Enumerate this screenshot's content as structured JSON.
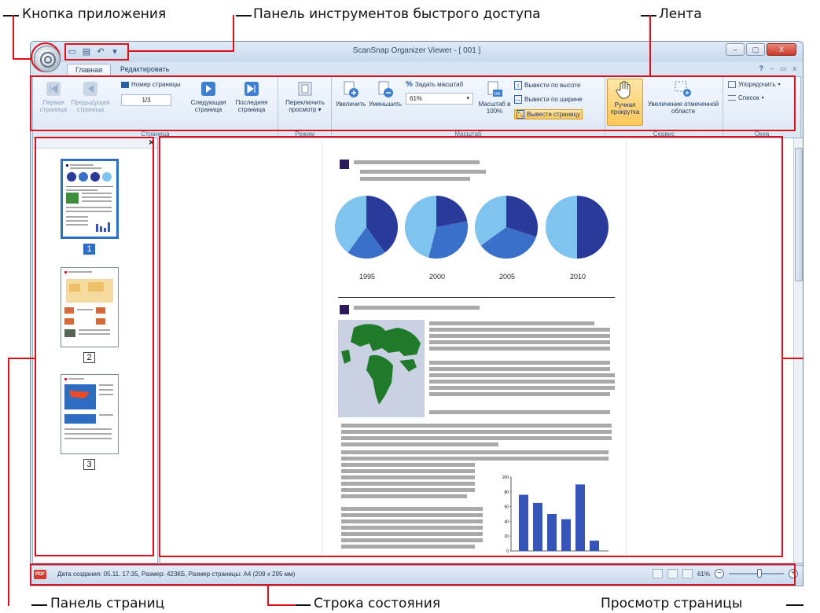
{
  "callouts": {
    "app_button": "Кнопка приложения",
    "quick_access": "Панель инструментов быстрого доступа",
    "ribbon": "Лента",
    "page_panel": "Панель страниц",
    "status_bar": "Строка состояния",
    "page_view": "Просмотр страницы"
  },
  "window": {
    "title": "ScanSnap Organizer Viewer - [ 001 ]",
    "controls": [
      "–",
      "▢",
      "X"
    ]
  },
  "qat_icons": [
    "save-icon",
    "print-icon",
    "back-icon",
    "dropdown-arrow-icon"
  ],
  "tabs": {
    "home": "Главная",
    "edit": "Редактировать",
    "right": [
      "?",
      "–",
      "▭",
      "x"
    ]
  },
  "ribbon": {
    "page_group": {
      "label": "Страница",
      "first": "Первая страница",
      "prev": "Предыдущая страница",
      "page_number_label": "Номер страницы",
      "page_number_value": "1/3",
      "next": "Следующая страница",
      "last": "Последняя страница"
    },
    "mode_group": {
      "label": "Режим",
      "switch_view": "Переключить просмотр"
    },
    "zoom_group": {
      "label": "Масштаб",
      "zoom_in": "Увеличить",
      "zoom_out": "Уменьшить",
      "set_zoom": "Задать масштаб",
      "zoom_value": "61%",
      "zoom_100": "Масштаб в 100%",
      "zoom_100_icon_text": "100",
      "fit_height": "Вывести по высоте",
      "fit_width": "Вывести по ширине",
      "fit_page": "Вывести страницу"
    },
    "service_group": {
      "label": "Сервис",
      "hand_scroll": "Ручная прокрутка",
      "zoom_area": "Увеличение отмеченной области"
    },
    "windows_group": {
      "label": "Окна",
      "arrange": "Упорядочить",
      "list": "Список"
    }
  },
  "page_panel": {
    "close": "×",
    "thumbnails": [
      {
        "num": "1",
        "selected": true
      },
      {
        "num": "2",
        "selected": false
      },
      {
        "num": "3",
        "selected": false
      }
    ]
  },
  "document": {
    "pie_years": [
      "1995",
      "2000",
      "2005",
      "2010"
    ],
    "pie_colors": {
      "dark": "#2a3a9a",
      "mid": "#3a70c8",
      "light": "#7fc4ef"
    },
    "pies": [
      {
        "year": "1995",
        "dark": 0.4,
        "mid": 0.2
      },
      {
        "year": "2000",
        "dark": 0.22,
        "mid": 0.32
      },
      {
        "year": "2005",
        "dark": 0.3,
        "mid": 0.35
      },
      {
        "year": "2010",
        "dark": 0.5,
        "mid": 0.0
      }
    ],
    "bar_chart": {
      "y_ticks": [
        "100",
        "80",
        "60",
        "40",
        "20",
        "0"
      ],
      "values": [
        76,
        65,
        50,
        43,
        90,
        14
      ],
      "color": "#3556b8"
    }
  },
  "status": {
    "pdf_icon": "PDF",
    "text": "Дата создания: 05.11.     17:35, Размер: 423КБ, Размер страницы: A4 (209 x 295 мм)",
    "zoom": "61%",
    "zoom_minus": "−",
    "zoom_plus": "+",
    "zoom_level": 0.61
  },
  "colors": {
    "callout_red": "#e0101a",
    "selection_blue": "#2f6ec8"
  }
}
